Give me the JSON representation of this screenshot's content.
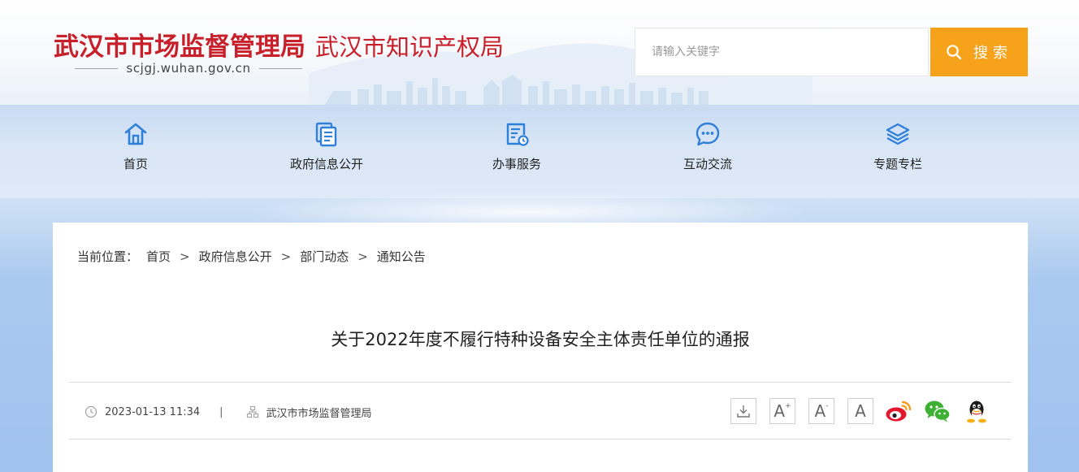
{
  "header": {
    "site_title": "武汉市市场监督管理局",
    "site_subtitle": "武汉市知识产权局",
    "domain": "scjgj.wuhan.gov.cn",
    "brand_color": "#c8202a"
  },
  "search": {
    "placeholder": "请输入关键字",
    "button_label": "搜索",
    "button_color": "#f7a21b"
  },
  "nav": {
    "items": [
      {
        "label": "首页",
        "icon": "home-icon"
      },
      {
        "label": "政府信息公开",
        "icon": "documents-icon"
      },
      {
        "label": "办事服务",
        "icon": "service-icon"
      },
      {
        "label": "互动交流",
        "icon": "chat-icon"
      },
      {
        "label": "专题专栏",
        "icon": "layers-icon"
      }
    ],
    "icon_color": "#2f80d8"
  },
  "breadcrumb": {
    "prefix": "当前位置：",
    "items": [
      "首页",
      "政府信息公开",
      "部门动态",
      "通知公告"
    ],
    "separator": ">"
  },
  "article": {
    "title": "关于2022年度不履行特种设备安全主体责任单位的通报",
    "date": "2023-01-13 11:34",
    "meta_separator": "|",
    "source": "武汉市市场监督管理局"
  },
  "tools": {
    "download": "download-icon",
    "font_large": "A",
    "font_small": "A",
    "font_normal": "A",
    "font_large_mark": "+",
    "font_small_mark": "-"
  },
  "share": [
    "weibo-icon",
    "wechat-icon",
    "qq-icon"
  ]
}
